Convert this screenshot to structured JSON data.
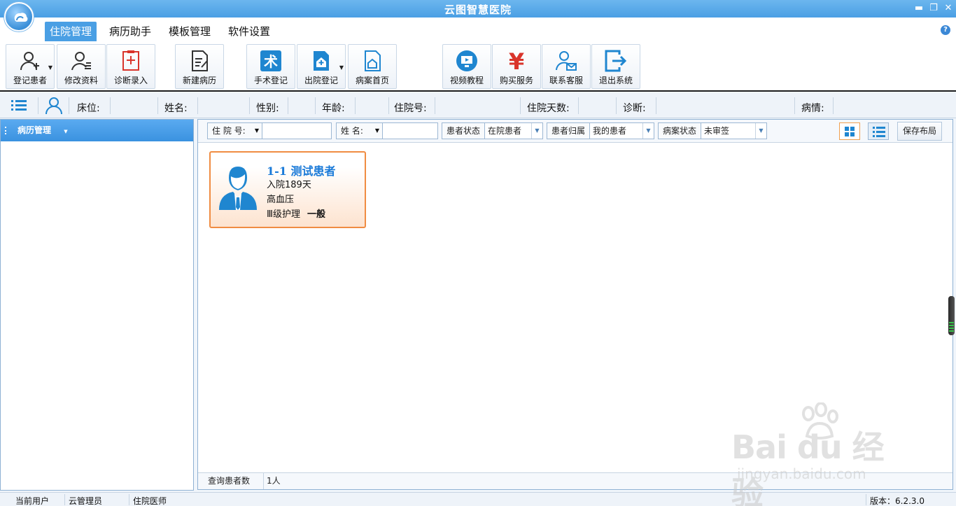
{
  "app": {
    "title": "云图智慧医院"
  },
  "window": {
    "minimize": "▬",
    "restore": "❐",
    "close": "✕"
  },
  "menu": {
    "items": [
      "住院管理",
      "病历助手",
      "模板管理",
      "软件设置"
    ],
    "help": "?"
  },
  "toolbar": {
    "buttons": [
      "登记患者",
      "修改资料",
      "诊断录入",
      "新建病历",
      "手术登记",
      "出院登记",
      "病案首页",
      "视频教程",
      "购买服务",
      "联系客服",
      "退出系统"
    ],
    "surgery_glyph": "术",
    "buy_glyph": "¥"
  },
  "patient_info": {
    "bed": "床位:",
    "name": "姓名:",
    "gender": "性别:",
    "age": "年龄:",
    "admission_no": "住院号:",
    "days": "住院天数:",
    "diagnosis": "诊断:",
    "condition": "病情:"
  },
  "left_panel": {
    "title": "病历管理",
    "arrow": "▼"
  },
  "filters": {
    "admission_no_label": "住 院 号:",
    "name_label": "姓 名:",
    "status_label": "患者状态",
    "status_value": "在院患者",
    "owner_label": "患者归属",
    "owner_value": "我的患者",
    "record_label": "病案状态",
    "record_value": "未审签",
    "dd_arrow": "▼",
    "save_layout": "保存布局"
  },
  "patient_card": {
    "title": "1-1 测试患者",
    "days": "入院189天",
    "diagnosis": "高血压",
    "nursing": "Ⅲ级护理",
    "condition": "一般"
  },
  "query": {
    "label": "查询患者数",
    "count": "1人"
  },
  "status_bar": {
    "current_user_label": "当前用户",
    "user": "云管理员",
    "role": "住院医师",
    "version": "版本：6.2.3.0"
  },
  "watermark": {
    "brand": "Bai du 经验",
    "url": "jingyan.baidu.com"
  },
  "colors": {
    "accent": "#4a9fe4",
    "card_border": "#f08c42",
    "card_title": "#1a7ad8"
  }
}
